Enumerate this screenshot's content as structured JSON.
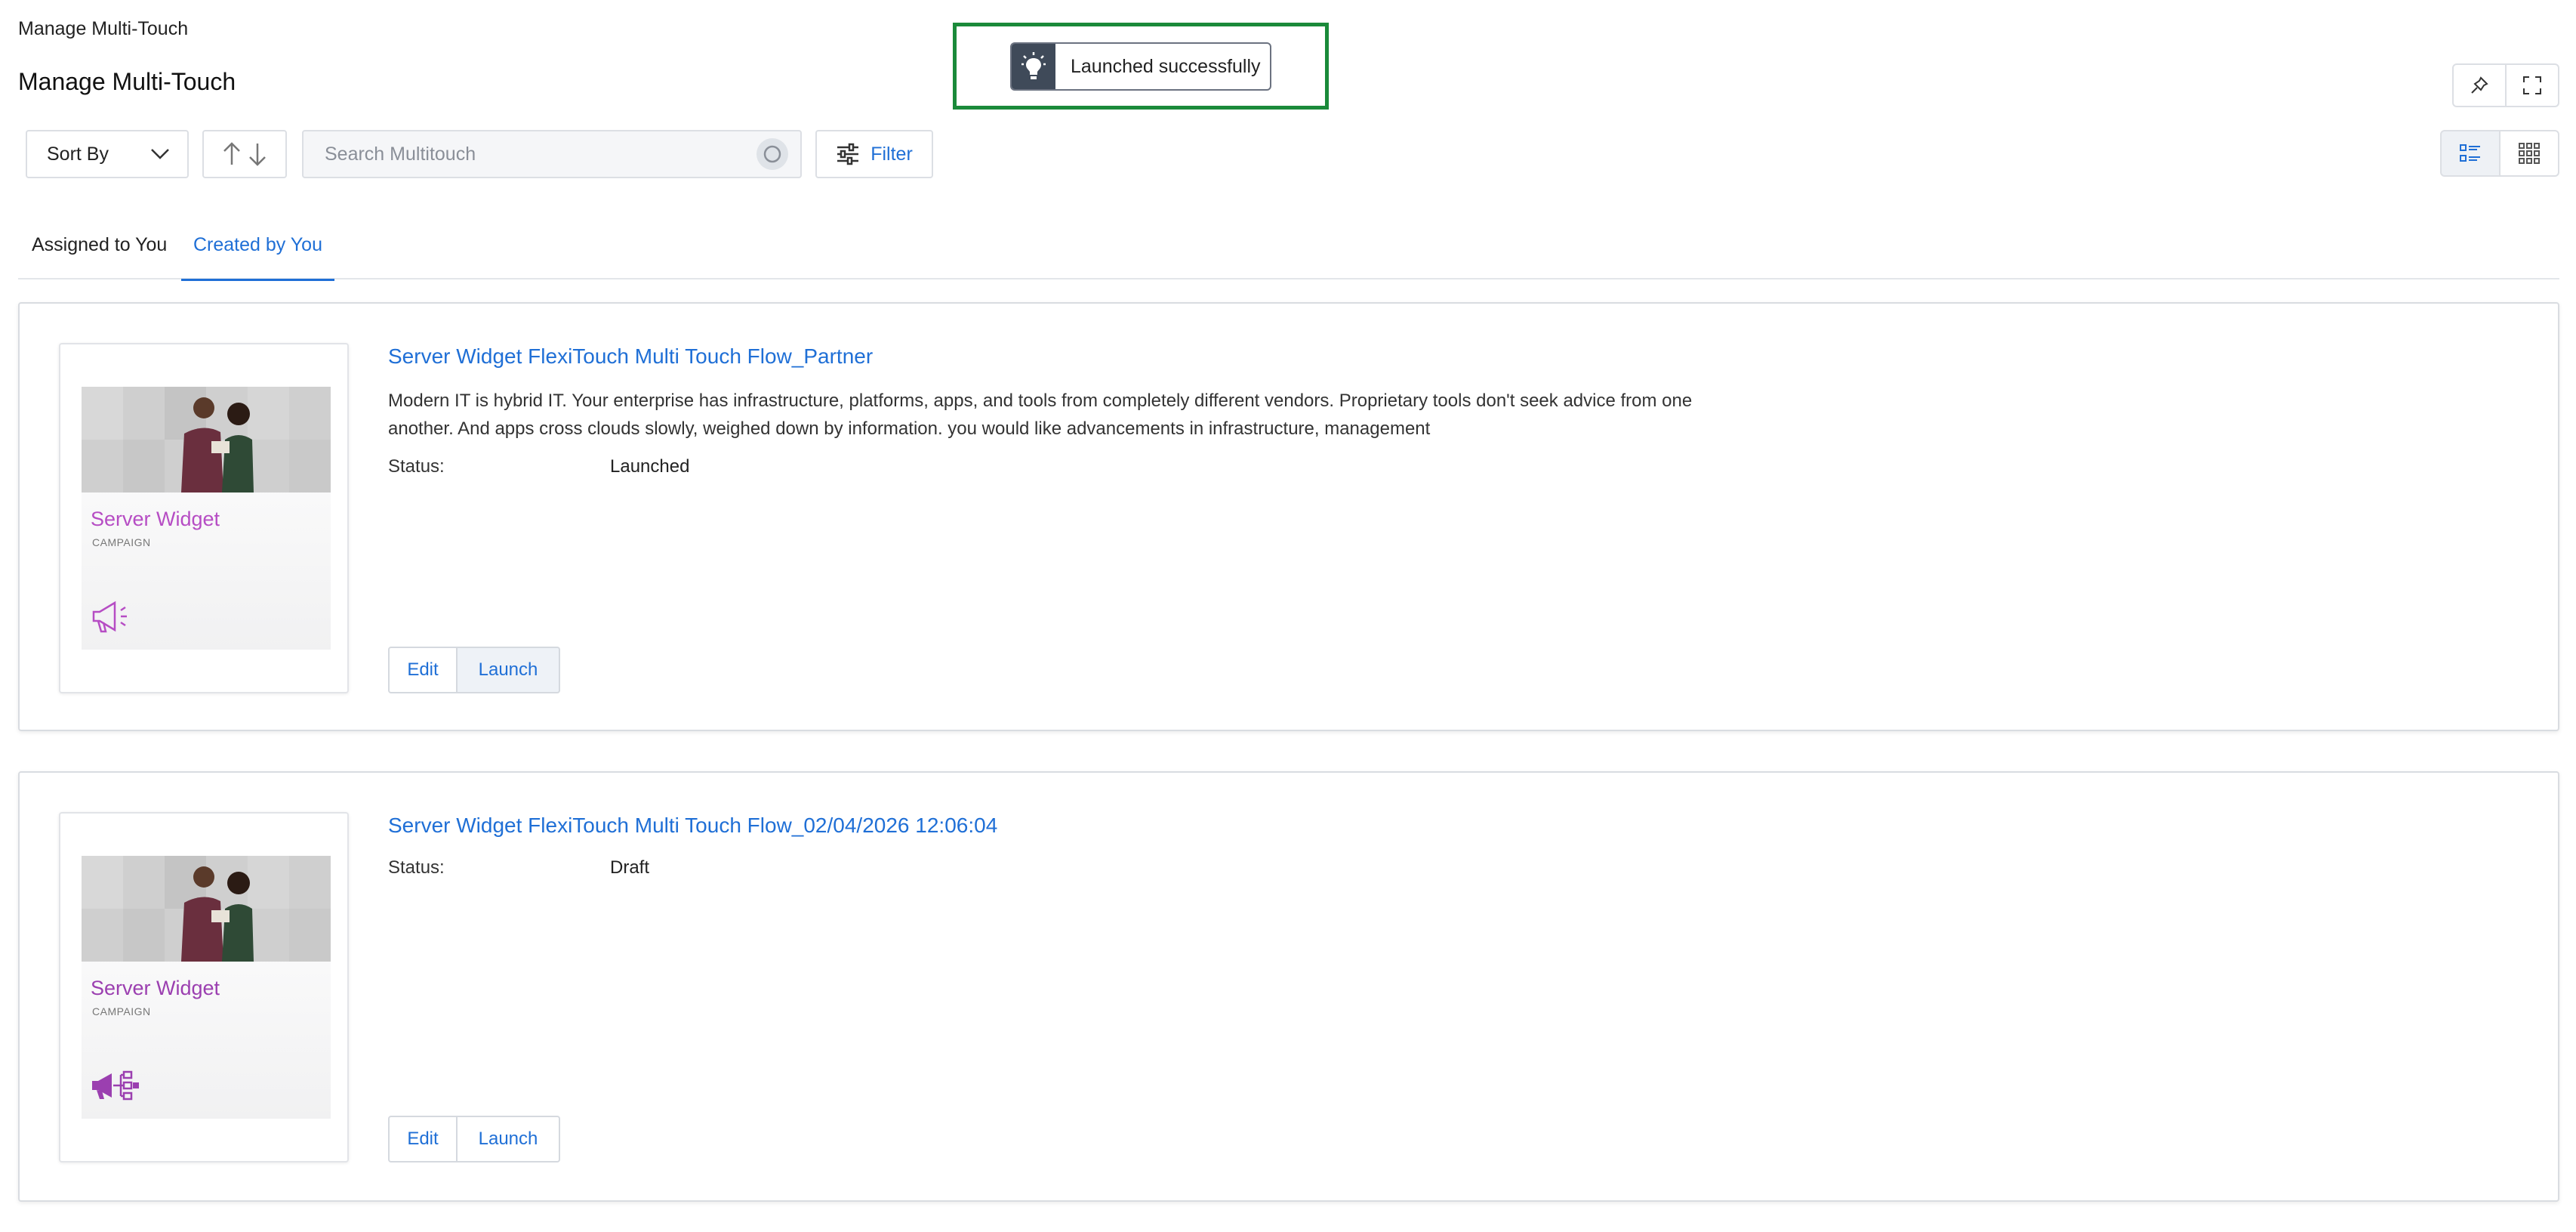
{
  "header": {
    "breadcrumb": "Manage Multi-Touch",
    "title": "Manage Multi-Touch"
  },
  "toast": {
    "message": "Launched successfully",
    "icon": "lightbulb-icon",
    "highlight_color": "#1a8a3a"
  },
  "toolbar": {
    "sort_label": "Sort By",
    "search_placeholder": "Search Multitouch",
    "search_value": "",
    "filter_label": "Filter",
    "view_mode": "list"
  },
  "tabs": [
    {
      "label": "Assigned to You",
      "active": false
    },
    {
      "label": "Created by You",
      "active": true
    }
  ],
  "cards": [
    {
      "title": "Server Widget FlexiTouch Multi Touch Flow_Partner",
      "description": "Modern IT is hybrid IT. Your enterprise has infrastructure, platforms, apps, and tools from completely different vendors. Proprietary tools don't seek advice from one another. And apps cross clouds slowly, weighed down by information. you would like advancements in infrastructure, management",
      "status_label": "Status:",
      "status_value": "Launched",
      "thumbnail_title": "Server Widget",
      "thumbnail_subtitle": "CAMPAIGN",
      "thumbnail_icon": "megaphone-outline-icon",
      "edit_label": "Edit",
      "launch_label": "Launch"
    },
    {
      "title": "Server Widget FlexiTouch Multi Touch Flow_02/04/2026 12:06:04",
      "description": "",
      "status_label": "Status:",
      "status_value": "Draft",
      "thumbnail_title": "Server Widget",
      "thumbnail_subtitle": "CAMPAIGN",
      "thumbnail_icon": "megaphone-network-icon",
      "edit_label": "Edit",
      "launch_label": "Launch"
    }
  ],
  "colors": {
    "accent": "#1f6fd6",
    "thumbnail_title": "#b64dc4",
    "toast_icon_bg": "#3f4a59"
  }
}
